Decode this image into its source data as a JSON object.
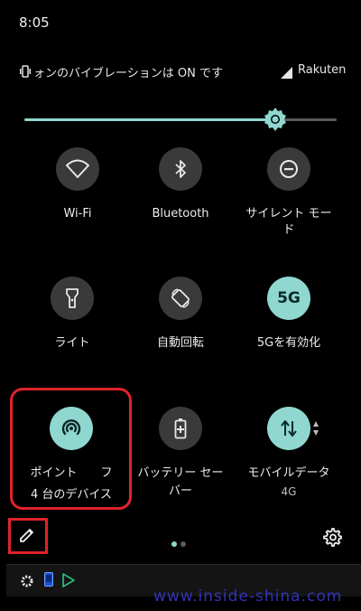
{
  "status_bar": {
    "time": "8:05"
  },
  "notice": {
    "text": "ォンのバイブレーションは ON です",
    "carrier": "Rakuten"
  },
  "brightness": {
    "level": 0.78
  },
  "tiles": [
    {
      "label": "Wi-Fi",
      "label2": "",
      "icon": "wifi-icon",
      "active": false
    },
    {
      "label": "Bluetooth",
      "label2": "",
      "icon": "bluetooth-icon",
      "active": false
    },
    {
      "label": "サイレント モー",
      "label2": "ド",
      "icon": "do-not-disturb-icon",
      "active": false
    },
    {
      "label": "ライト",
      "label2": "",
      "icon": "flashlight-icon",
      "active": false
    },
    {
      "label": "自動回転",
      "label2": "",
      "icon": "auto-rotate-icon",
      "active": false
    },
    {
      "label": "5Gを有効化",
      "label2": "",
      "icon": "5g-icon",
      "icon_text": "5G",
      "active": true
    },
    {
      "label": "ポイント　　フ",
      "label2": "4 台のデバイス",
      "icon": "hotspot-icon",
      "active": true
    },
    {
      "label": "バッテリー セー",
      "label2": "バー",
      "icon": "battery-saver-icon",
      "active": false
    },
    {
      "label": "モバイルデータ",
      "label2": "4G",
      "icon": "mobile-data-icon",
      "active": true
    }
  ],
  "pager": {
    "pages": 2,
    "current": 1
  },
  "colors": {
    "accent": "#8fd7cf",
    "tile_off": "#3a3a3a",
    "highlight": "#e0232a",
    "watermark": "#3b3ad8"
  },
  "watermark": "www.inside-shina.com"
}
